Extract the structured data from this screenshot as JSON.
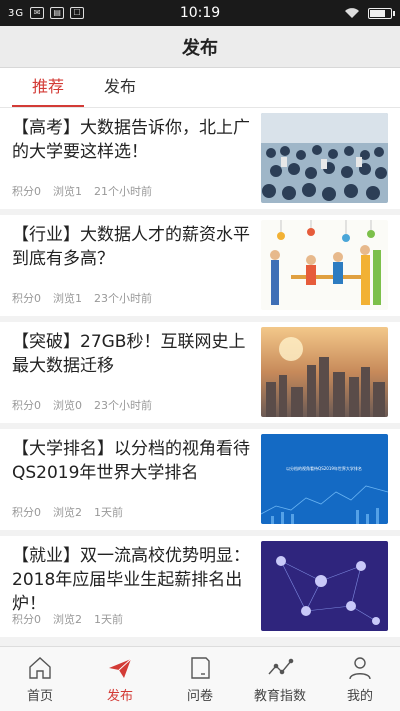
{
  "status_bar": {
    "signal": "3G",
    "time": "10:19"
  },
  "header": {
    "title": "发布"
  },
  "tabs": [
    {
      "label": "推荐",
      "active": true
    },
    {
      "label": "发布",
      "active": false
    }
  ],
  "articles": [
    {
      "title": "【高考】大数据告诉你，北上广的大学要这样选！",
      "points": "积分0",
      "views": "浏览1",
      "time": "21个小时前",
      "thumb": "crowd-photo"
    },
    {
      "title": "【行业】大数据人才的薪资水平到底有多高？",
      "points": "积分0",
      "views": "浏览1",
      "time": "23个小时前",
      "thumb": "people-illustration"
    },
    {
      "title": "【突破】27GB秒！互联网史上最大数据迁移",
      "points": "积分0",
      "views": "浏览0",
      "time": "23个小时前",
      "thumb": "city-sunset"
    },
    {
      "title": "【大学排名】以分档的视角看待QS2019年世界大学排名",
      "points": "积分0",
      "views": "浏览2",
      "time": "1天前",
      "thumb": "blue-chart",
      "thumb_caption": "以分档的视角看待QS2019年世界大学排名"
    },
    {
      "title": "【就业】双一流高校优势明显：2018年应届毕业生起薪排名出炉！",
      "points": "积分0",
      "views": "浏览2",
      "time": "1天前",
      "thumb": "network-graph"
    }
  ],
  "bottom_nav": [
    {
      "label": "首页",
      "icon": "home-icon",
      "active": false
    },
    {
      "label": "发布",
      "icon": "paper-plane-icon",
      "active": true
    },
    {
      "label": "问卷",
      "icon": "document-icon",
      "active": false
    },
    {
      "label": "教育指数",
      "icon": "trend-icon",
      "active": false
    },
    {
      "label": "我的",
      "icon": "user-icon",
      "active": false
    }
  ],
  "colors": {
    "accent": "#d33b36"
  }
}
